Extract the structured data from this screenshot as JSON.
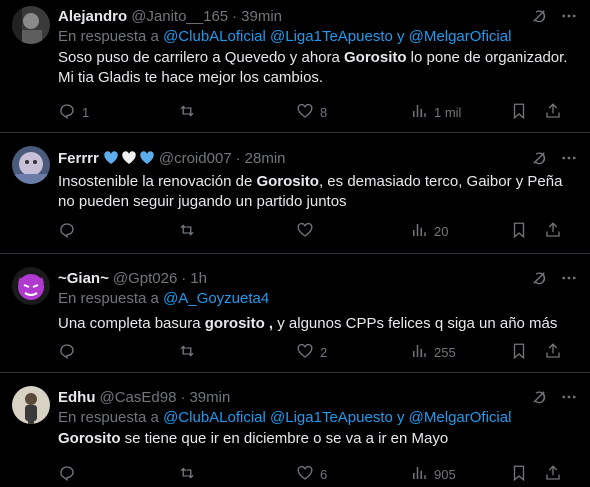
{
  "tweets": [
    {
      "name": "Alejandro",
      "handle": "@Janito__165",
      "time": "39min",
      "reply_prefix": "En respuesta a",
      "reply_mentions": "@ClubALoficial @Liga1TeApuesto y @MelgarOficial",
      "text_parts": [
        "Soso puso de carrilero a Quevedo y ahora ",
        "Gorosito",
        " lo pone de organizador. Mi tia Gladis te hace mejor los cambios."
      ],
      "replies": "1",
      "retweets": "",
      "likes": "8",
      "views": "1 mil"
    },
    {
      "name": "Ferrrr",
      "hearts": [
        "💙",
        "🤍",
        "💙"
      ],
      "handle": "@croid007",
      "time": "28min",
      "text_parts": [
        "Insostenible la renovación de ",
        "Gorosito",
        ", es demasiado terco, Gaibor y Peña no pueden seguir jugando un partido juntos"
      ],
      "replies": "",
      "retweets": "",
      "likes": "",
      "views": "20"
    },
    {
      "name": "~Gian~",
      "handle": "@Gpt026",
      "time": "1h",
      "reply_prefix": "En respuesta a",
      "reply_mentions": "@A_Goyzueta4",
      "text_parts": [
        "Una completa basura ",
        "gorosito ,",
        " y algunos CPPs felices q siga un año más"
      ],
      "replies": "",
      "retweets": "",
      "likes": "2",
      "views": "255"
    },
    {
      "name": "Edhu",
      "handle": "@CasEd98",
      "time": "39min",
      "reply_prefix": "En respuesta a",
      "reply_mentions": "@ClubALoficial @Liga1TeApuesto y @MelgarOficial",
      "text_parts": [
        "",
        "Gorosito",
        " se tiene que ir en diciembre o se va a ir en Mayo"
      ],
      "replies": "",
      "retweets": "",
      "likes": "6",
      "views": "905"
    }
  ],
  "colors": {
    "background": "#000000",
    "text": "#e7e9ea",
    "secondary": "#71767b",
    "link": "#1d9bf0",
    "divider": "#2f3336"
  },
  "icons": [
    "grok-icon",
    "more-icon",
    "reply-icon",
    "retweet-icon",
    "like-icon",
    "views-icon"
  ]
}
